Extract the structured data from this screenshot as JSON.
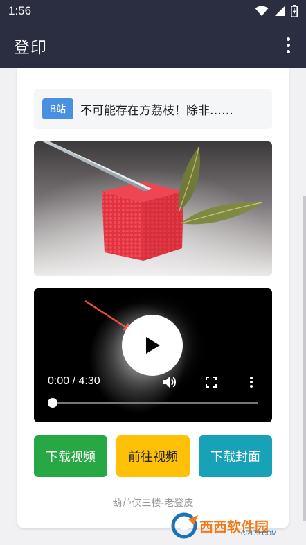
{
  "status_bar": {
    "time": "1:56",
    "icons": [
      "wifi-icon",
      "signal-icon",
      "battery-icon"
    ]
  },
  "app_bar": {
    "title": "登印",
    "menu_icon": "more-vert-icon"
  },
  "video_card": {
    "badge": "B站",
    "title": "不可能存在方荔枝！除非……",
    "player": {
      "time": "0:00 / 4:30",
      "progress": 0
    },
    "buttons": {
      "download_video": "下载视频",
      "goto_video": "前往视频",
      "download_cover": "下载封面"
    },
    "footer": "葫芦侠三楼-老登皮"
  },
  "watermark": {
    "brand": "西西软件园",
    "url": "CR173.COM"
  },
  "colors": {
    "app_bar": "#2b2d40",
    "badge": "#4a90e2",
    "download": "#28a745",
    "goto": "#ffc107",
    "cover": "#17a2b8"
  }
}
